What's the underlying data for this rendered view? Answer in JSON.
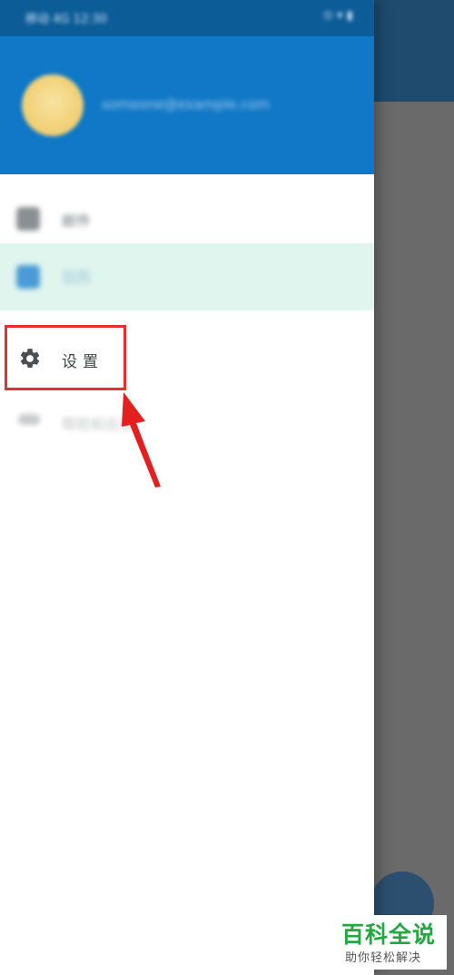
{
  "statusbar": {
    "left_text": "移动 4G 12:30",
    "right_text": "⊙ ▾ ▮"
  },
  "account": {
    "email": "someone@example.com"
  },
  "menu": {
    "items": [
      {
        "label": "邮件",
        "icon": "mail-icon"
      },
      {
        "label": "日历",
        "icon": "calendar-icon"
      }
    ],
    "settings": {
      "label": "设置",
      "icon": "gear-icon"
    },
    "feedback": {
      "label": "帮助和反馈",
      "icon": "wrench-icon"
    }
  },
  "annotation": {
    "highlight_color": "#e23030",
    "target": "settings"
  },
  "watermark": {
    "title": "百科全说",
    "subtitle": "助你轻松解决"
  },
  "colors": {
    "header": "#1078c6",
    "statusbar": "#0c5c98",
    "selected_row": "#dff5ee",
    "backdrop": "#6a6a6a"
  }
}
